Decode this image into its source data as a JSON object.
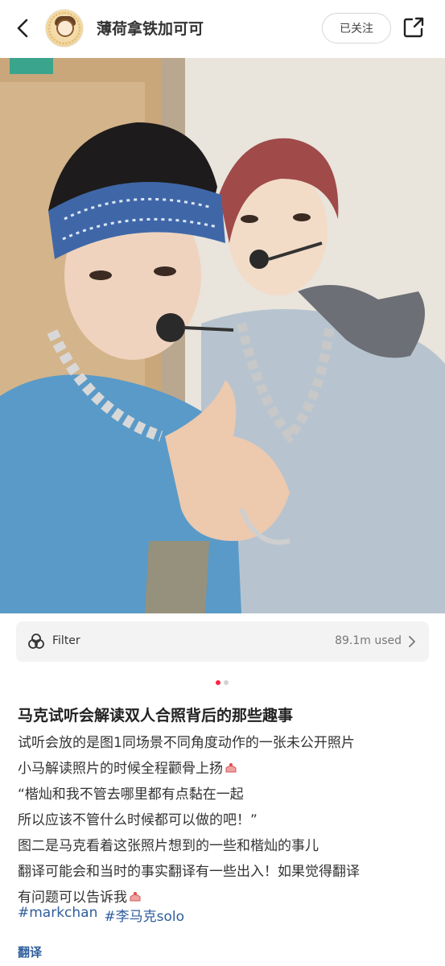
{
  "header": {
    "username": "薄荷拿铁加可可",
    "follow_label": "已关注"
  },
  "photo": {
    "description_icon": "photo"
  },
  "filter": {
    "label": "Filter",
    "usage": "89.1m used"
  },
  "pager": {
    "current": 1,
    "total": 2
  },
  "post": {
    "title": "马克试听会解读双人合照背后的那些趣事",
    "lines": [
      "试听会放的是图1同场景不同角度动作的一张未公开照片",
      "小马解读照片的时候全程颧骨上扬",
      "“楷灿和我不管去哪里都有点黏在一起",
      "所以应该不管什么时候都可以做的吧！”",
      "图二是马克看着这张照片想到的一些和楷灿的事儿",
      "翻译可能会和当时的事实翻译有一些出入！如果觉得翻译",
      "有问题可以告诉我"
    ],
    "tags": [
      "#markchan",
      "#李马克solo"
    ],
    "translate_label": "翻译"
  },
  "colors": {
    "accent": "#ff2442",
    "link": "#2f5d9c"
  }
}
